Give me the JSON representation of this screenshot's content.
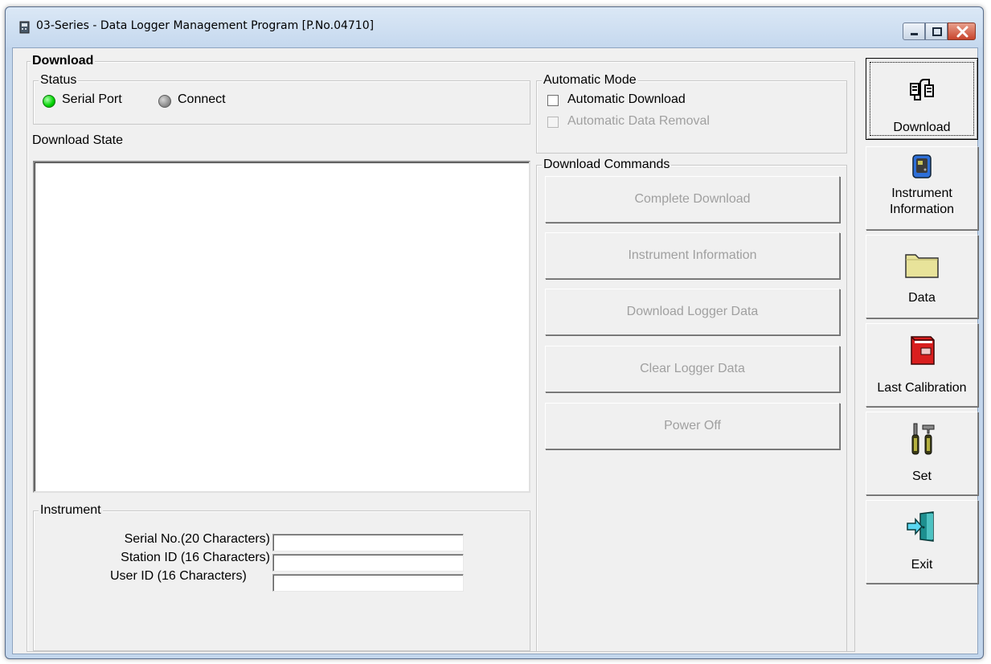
{
  "window": {
    "title": "03-Series  - Data Logger Management Program [P.No.04710]"
  },
  "download_group": {
    "label": "Download"
  },
  "status": {
    "label": "Status",
    "serial_port": "Serial Port",
    "connect": "Connect",
    "serial_port_color": "#00d200",
    "connect_color": "#8f8f8f"
  },
  "download_state": {
    "label": "Download State"
  },
  "automatic_mode": {
    "label": "Automatic Mode",
    "automatic_download": "Automatic Download",
    "automatic_download_checked": false,
    "automatic_data_removal": "Automatic Data Removal",
    "automatic_data_removal_checked": false
  },
  "download_commands": {
    "label": "Download Commands",
    "buttons": [
      "Complete Download",
      "Instrument Information",
      "Download Logger Data",
      "Clear Logger Data",
      "Power Off"
    ]
  },
  "instrument": {
    "label": "Instrument",
    "serial_no_label": "Serial No.(20 Characters)",
    "serial_no_value": "",
    "station_id_label": "Station ID (16 Characters)",
    "station_id_value": "",
    "user_id_label": "User ID (16 Characters)",
    "user_id_value": ""
  },
  "sidebar": {
    "download": "Download",
    "instrument_information_line1": "Instrument",
    "instrument_information_line2": "Information",
    "data": "Data",
    "last_calibration": "Last Calibration",
    "set": "Set",
    "exit": "Exit"
  },
  "icons": {
    "app": "app-icon",
    "download": "connector-plug-icon",
    "instrument_information": "device-icon",
    "data": "folder-icon",
    "last_calibration": "red-book-icon",
    "set": "tools-icon",
    "exit": "exit-door-icon"
  }
}
